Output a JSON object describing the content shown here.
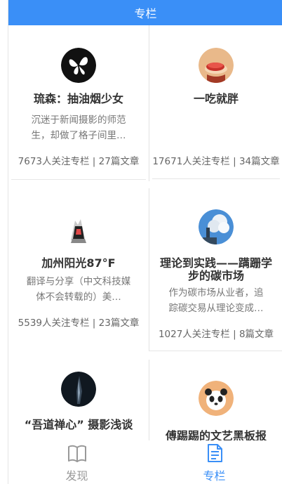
{
  "header": {
    "title": "专栏"
  },
  "columns": [
    {
      "title": "琉森：抽油烟少女",
      "description": "沉迷于新闻摄影的师范生，却做了格子间里…",
      "followers": "7673人关注专栏",
      "articles": "27篇文章"
    },
    {
      "title": "一吃就胖",
      "description": "",
      "followers": "17671人关注专栏",
      "articles": "34篇文章"
    },
    {
      "title": "加州阳光87°F",
      "description": "翻译与分享（中文科技媒体不会转载的）美…",
      "followers": "5539人关注专栏",
      "articles": "23篇文章"
    },
    {
      "title": "理论到实践——蹒跚学步的碳市场",
      "description": "作为碳市场从业者，追踪碳交易从理论变成…",
      "followers": "1027人关注专栏",
      "articles": "8篇文章"
    },
    {
      "title": "“吾道禅心” 摄影浅谈",
      "description": "",
      "followers": "",
      "articles": ""
    },
    {
      "title": "傅踢踢的文艺黑板报",
      "description": "",
      "followers": "",
      "articles": ""
    }
  ],
  "stats_separator": "|",
  "tabbar": {
    "discover": {
      "label": "发现",
      "icon": "book-icon",
      "color": "#999999"
    },
    "columns": {
      "label": "专栏",
      "icon": "document-icon",
      "color": "#3a8ff7"
    }
  },
  "colors": {
    "accent": "#3a8ff7"
  }
}
